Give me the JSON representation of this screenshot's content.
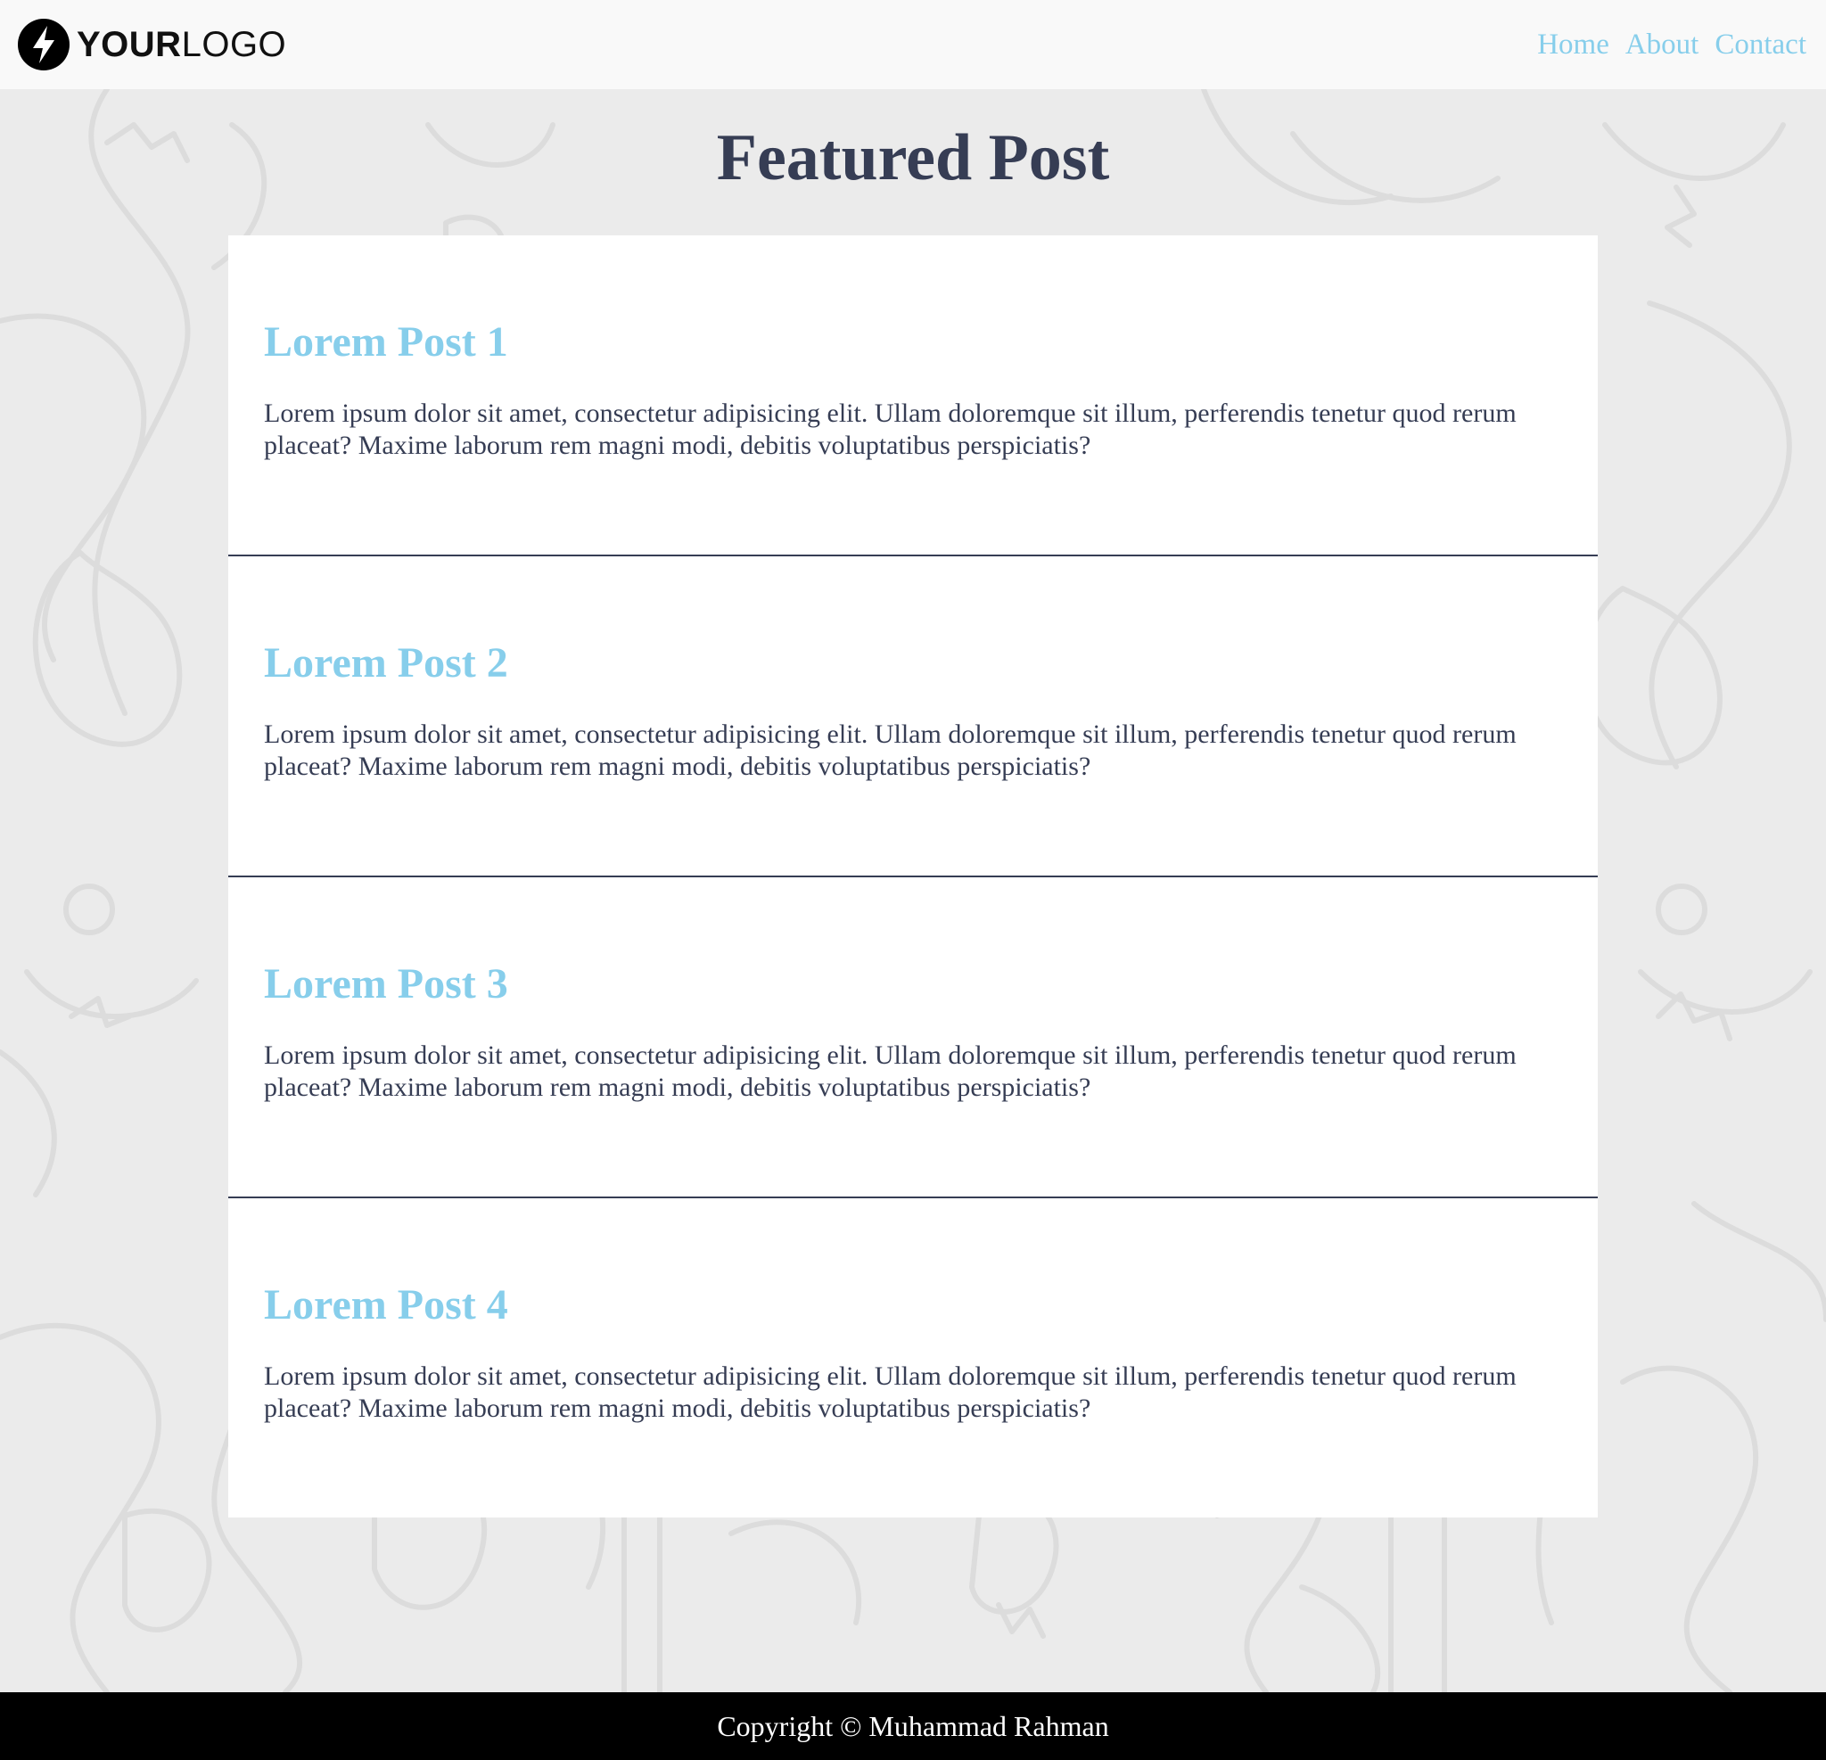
{
  "header": {
    "logo_bold": "YOUR",
    "logo_light": "LOGO",
    "nav": [
      "Home",
      "About",
      "Contact"
    ]
  },
  "main": {
    "title": "Featured Post",
    "posts": [
      {
        "title": "Lorem Post 1",
        "body": "Lorem ipsum dolor sit amet, consectetur adipisicing elit. Ullam doloremque sit illum, perferendis tenetur quod rerum placeat? Maxime laborum rem magni modi, debitis voluptatibus perspiciatis?"
      },
      {
        "title": "Lorem Post 2",
        "body": "Lorem ipsum dolor sit amet, consectetur adipisicing elit. Ullam doloremque sit illum, perferendis tenetur quod rerum placeat? Maxime laborum rem magni modi, debitis voluptatibus perspiciatis?"
      },
      {
        "title": "Lorem Post 3",
        "body": "Lorem ipsum dolor sit amet, consectetur adipisicing elit. Ullam doloremque sit illum, perferendis tenetur quod rerum placeat? Maxime laborum rem magni modi, debitis voluptatibus perspiciatis?"
      },
      {
        "title": "Lorem Post 4",
        "body": "Lorem ipsum dolor sit amet, consectetur adipisicing elit. Ullam doloremque sit illum, perferendis tenetur quod rerum placeat? Maxime laborum rem magni modi, debitis voluptatibus perspiciatis?"
      }
    ]
  },
  "footer": {
    "copyright": "Copyright © Muhammad Rahman"
  },
  "colors": {
    "accent": "#87ceeb",
    "text": "#363d54",
    "header_bg": "#f9f9f9",
    "page_bg": "#ebebeb",
    "footer_bg": "#000000"
  }
}
